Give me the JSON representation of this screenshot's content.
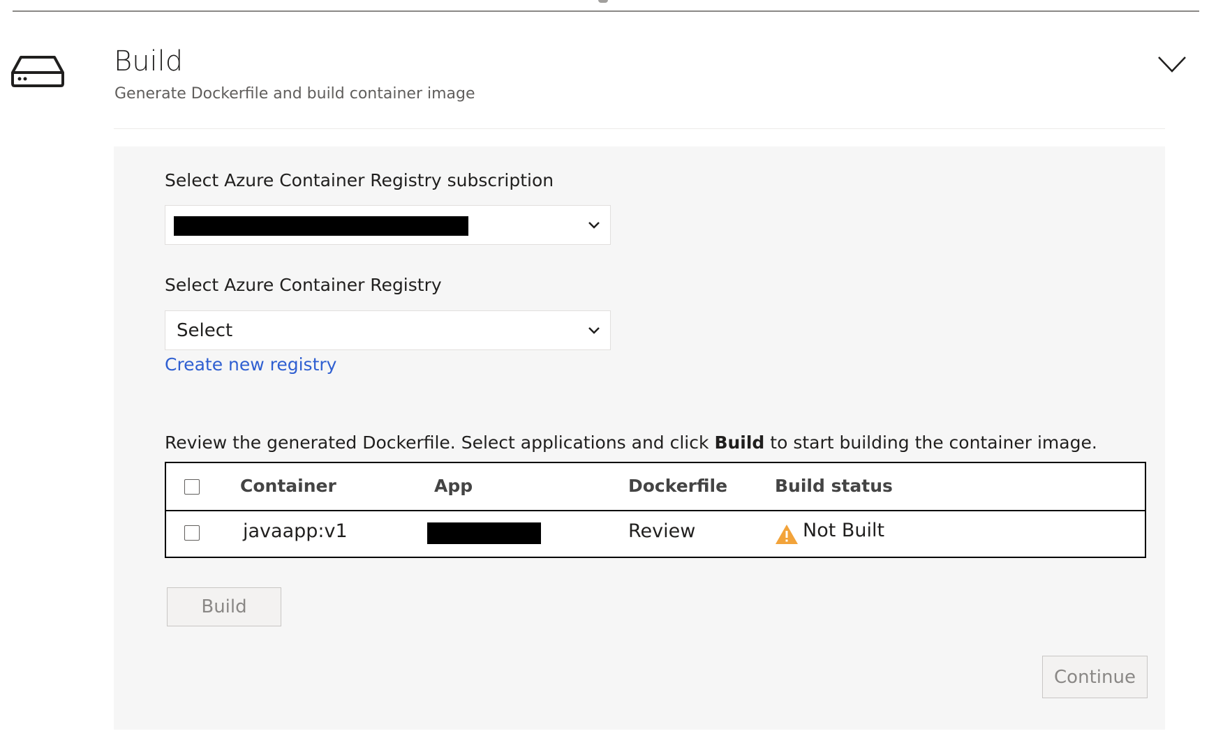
{
  "section": {
    "title": "Build",
    "subtitle": "Generate Dockerfile and build container image"
  },
  "form": {
    "subscription_label": "Select Azure Container Registry subscription",
    "subscription_value": "",
    "registry_label": "Select Azure Container Registry",
    "registry_value": "Select",
    "create_registry_link": "Create new registry"
  },
  "instruction": {
    "before": "Review the generated Dockerfile. Select applications and click ",
    "bold": "Build",
    "after": " to start building the container image."
  },
  "table": {
    "headers": {
      "container": "Container",
      "app": "App",
      "dockerfile": "Dockerfile",
      "build_status": "Build status"
    },
    "rows": [
      {
        "container": "javaapp:v1",
        "app": "",
        "dockerfile_link": "Review",
        "build_status": "Not Built",
        "status_icon": "warning-icon",
        "checked": false
      }
    ]
  },
  "buttons": {
    "build": "Build",
    "continue": "Continue"
  },
  "colors": {
    "link": "#2f5fd1",
    "warning": "#f2a33a",
    "panel_background": "#f6f6f6"
  }
}
